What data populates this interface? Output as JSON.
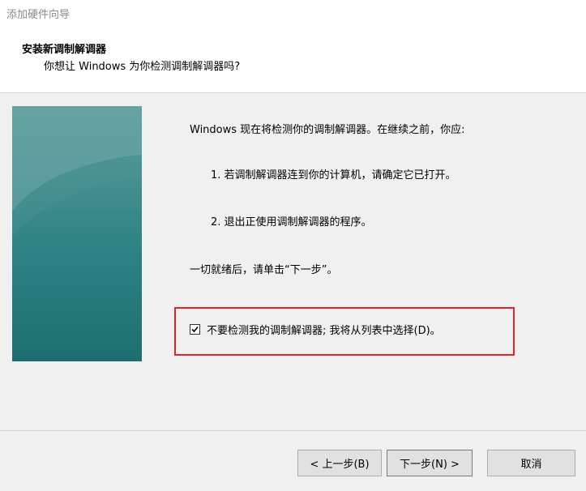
{
  "window": {
    "title": "添加硬件向导"
  },
  "header": {
    "title": "安装新调制解调器",
    "subtitle": "你想让 Windows 为你检测调制解调器吗?"
  },
  "body": {
    "intro": "Windows 现在将检测你的调制解调器。在继续之前，你应:",
    "item1": "1. 若调制解调器连到你的计算机，请确定它已打开。",
    "item2": "2. 退出正使用调制解调器的程序。",
    "outro": "一切就绪后，请单击“下一步”。"
  },
  "option": {
    "checked": true,
    "label": "不要检测我的调制解调器; 我将从列表中选择(D)。"
  },
  "buttons": {
    "back": "< 上一步(B)",
    "next": "下一步(N) >",
    "cancel": "取消"
  },
  "colors": {
    "highlight": "#d9262c",
    "side_panel": "#2f8384"
  }
}
